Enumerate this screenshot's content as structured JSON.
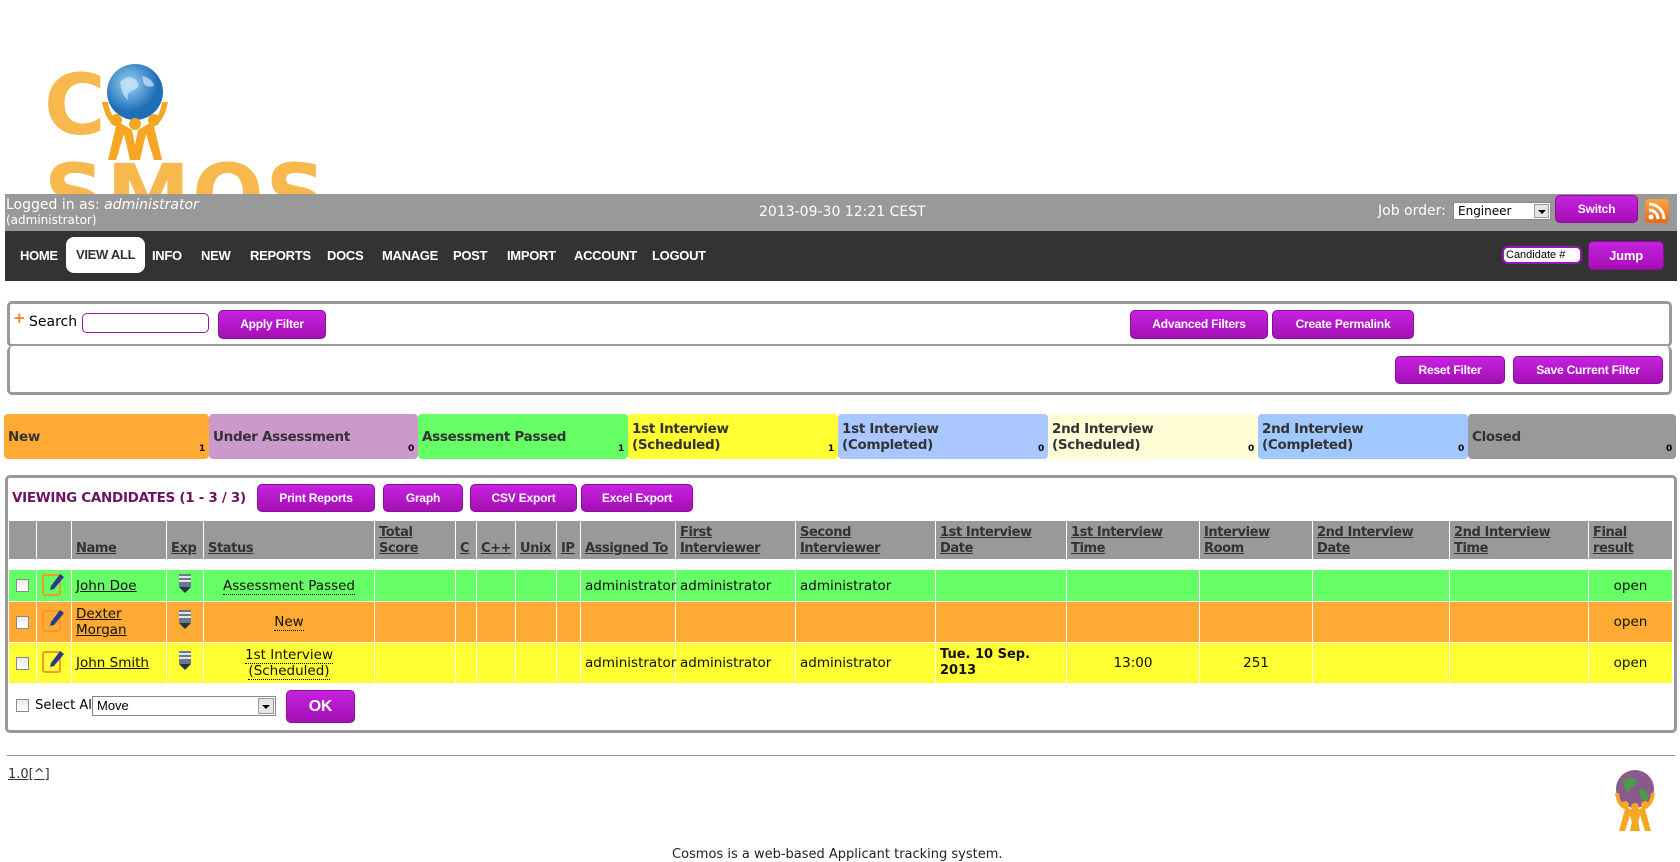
{
  "app": {
    "logo_text_pre": "C",
    "logo_text_post": "SMOS"
  },
  "topbar": {
    "logged_in_prefix": "Logged in as: ",
    "logged_in_user": "administrator",
    "logged_in_role": "(administrator)",
    "datetime": "2013-09-30 12:21 CEST",
    "job_order_label": "Job order:",
    "job_order_value": "Engineer",
    "switch_label": "Switch",
    "rss_icon": "rss-icon"
  },
  "nav": {
    "items": [
      {
        "label": "HOME",
        "active": false
      },
      {
        "label": "VIEW ALL",
        "active": true
      },
      {
        "label": "INFO",
        "active": false
      },
      {
        "label": "NEW",
        "active": false
      },
      {
        "label": "REPORTS",
        "active": false
      },
      {
        "label": "DOCS",
        "active": false
      },
      {
        "label": "MANAGE",
        "active": false
      },
      {
        "label": "POST",
        "active": false
      },
      {
        "label": "IMPORT",
        "active": false
      },
      {
        "label": "ACCOUNT",
        "active": false
      },
      {
        "label": "LOGOUT",
        "active": false
      }
    ],
    "jump_placeholder": "Candidate #",
    "jump_label": "Jump"
  },
  "filter": {
    "search_label": "Search",
    "search_value": "",
    "apply_label": "Apply Filter",
    "advanced_label": "Advanced Filters",
    "permalink_label": "Create Permalink",
    "reset_label": "Reset Filter",
    "save_label": "Save Current Filter"
  },
  "pipeline": [
    {
      "label": "New",
      "count": "1",
      "color": "#ffaa33"
    },
    {
      "label": "Under Assessment",
      "count": "0",
      "color": "#cc99cc"
    },
    {
      "label": "Assessment Passed",
      "count": "1",
      "color": "#66ff66"
    },
    {
      "label": "1st Interview (Scheduled)",
      "count": "1",
      "color": "#ffff33"
    },
    {
      "label": "1st Interview (Completed)",
      "count": "0",
      "color": "#aac8ff"
    },
    {
      "label": "2nd Interview (Scheduled)",
      "count": "0",
      "color": "#fffcd6"
    },
    {
      "label": "2nd Interview (Completed)",
      "count": "0",
      "color": "#a0c8ff"
    },
    {
      "label": "Closed",
      "count": "0",
      "color": "#999999"
    }
  ],
  "candidates": {
    "title": "VIEWING CANDIDATES (1 - 3 / 3)",
    "actions": {
      "print": "Print Reports",
      "graph": "Graph",
      "csv": "CSV Export",
      "excel": "Excel Export"
    },
    "columns": [
      "",
      "",
      "Name",
      "Exp",
      "Status",
      "Total Score",
      "C",
      "C++",
      "Unix",
      "IP",
      "Assigned To",
      "First Interviewer",
      "Second Interviewer",
      "1st Interview Date",
      "1st Interview Time",
      "Interview Room",
      "2nd Interview Date",
      "2nd Interview Time",
      "Final result"
    ],
    "rows": [
      {
        "name": "John Doe",
        "status": "Assessment Passed",
        "total_score": "",
        "c": "",
        "cpp": "",
        "unix": "",
        "ip": "",
        "assigned_to": "administrator",
        "first_interviewer": "administrator",
        "second_interviewer": "administrator",
        "first_date": "",
        "first_time": "",
        "room": "",
        "second_date": "",
        "second_time": "",
        "final": "open",
        "color": "#66ff66"
      },
      {
        "name": "Dexter Morgan",
        "status": "New",
        "total_score": "",
        "c": "",
        "cpp": "",
        "unix": "",
        "ip": "",
        "assigned_to": "",
        "first_interviewer": "",
        "second_interviewer": "",
        "first_date": "",
        "first_time": "",
        "room": "",
        "second_date": "",
        "second_time": "",
        "final": "open",
        "color": "#ffaa33"
      },
      {
        "name": "John Smith",
        "status": "1st Interview (Scheduled)",
        "total_score": "",
        "c": "",
        "cpp": "",
        "unix": "",
        "ip": "",
        "assigned_to": "administrator",
        "first_interviewer": "administrator",
        "second_interviewer": "administrator",
        "first_date": "Tue. 10 Sep. 2013",
        "first_time": "13:00",
        "room": "251",
        "second_date": "",
        "second_time": "",
        "final": "open",
        "color": "#ffff33"
      }
    ],
    "select_all_label": "Select All",
    "bulk_action_value": "Move",
    "ok_label": "OK"
  },
  "footer": {
    "version": "1.0[^]",
    "tagline": "Cosmos is a web-based Applicant tracking system."
  }
}
